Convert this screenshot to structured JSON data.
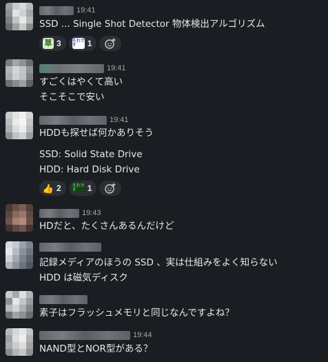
{
  "messages": [
    {
      "time": "19:41",
      "lines": [
        "SSD ... Single Shot Detector 物体検出アルゴリズム"
      ],
      "reactions": [
        {
          "emoji_name": "kusa-emoji",
          "emoji_text": "草",
          "count": "3"
        },
        {
          "emoji_name": "soredesu-emoji",
          "emoji_text": "それです",
          "count": "1"
        }
      ]
    },
    {
      "time": "19:41",
      "lines": [
        "すごくはやくて高い",
        "そこそこで安い"
      ]
    },
    {
      "time": "19:41",
      "lines": [
        "HDDも探せば何かありそう",
        "SSD: Solid State Drive",
        "HDD: Hard Disk Drive"
      ],
      "reactions": [
        {
          "emoji_name": "thumbs-up-emoji",
          "emoji_text": "👍",
          "count": "2"
        },
        {
          "emoji_name": "soredesu-emoji",
          "emoji_text": "それです",
          "count": "1"
        }
      ]
    },
    {
      "time": "19:43",
      "lines": [
        "HDだと、たくさんあるんだけど"
      ]
    },
    {
      "time": "",
      "lines": [
        "記録メディアのほうの SSD 、実は仕組みをよく知らない",
        "HDD は磁気ディスク"
      ]
    },
    {
      "time": "",
      "lines": [
        "素子はフラッシュメモリと同じなんですよね？"
      ]
    },
    {
      "time": "19:44",
      "lines": [
        "NAND型とNOR型がある？"
      ]
    }
  ]
}
